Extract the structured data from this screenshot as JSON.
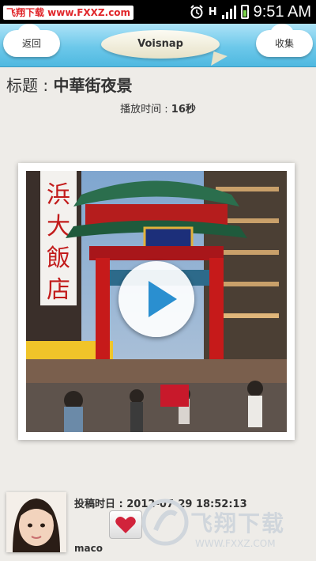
{
  "status_bar": {
    "watermark": "飞翔下载 www.FXXZ.com",
    "network_label": "H",
    "time": "9:51 AM"
  },
  "header": {
    "back_label": "返回",
    "app_title": "Voisnap",
    "favorite_label": "收集"
  },
  "post": {
    "title_label": "标题 : ",
    "title": "中華街夜景",
    "duration_label": "播放时间 : ",
    "duration": "16秒",
    "posted_label": "投稿时日 : ",
    "posted_time": "2012-07-29 18:52:13",
    "username": "maco"
  },
  "watermark_bottom": {
    "brand": "飞翔下载",
    "url": "WWW.FXXZ.COM"
  }
}
